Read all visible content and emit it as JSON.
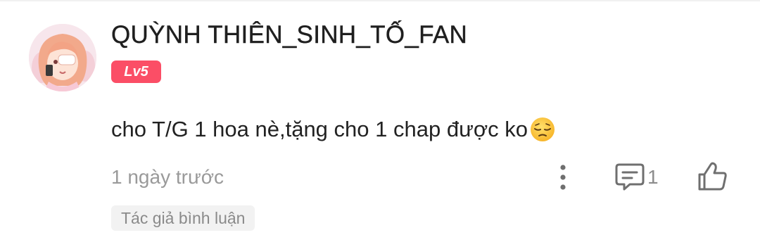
{
  "comment": {
    "username": "QUỲNH THIÊN_SINH_TỐ_FAN",
    "level": "Lv5",
    "text": "cho T/G 1 hoa nè,tặng cho 1 chap được ko",
    "emoji": "pensive-face-icon",
    "timestamp": "1 ngày trước",
    "reply_count": "1",
    "author_tag": "Tác giả bình luận"
  },
  "colors": {
    "level_badge": "#fb4e66",
    "meta_text": "#9a9a9a",
    "icon_gray": "#7a7a7a"
  }
}
